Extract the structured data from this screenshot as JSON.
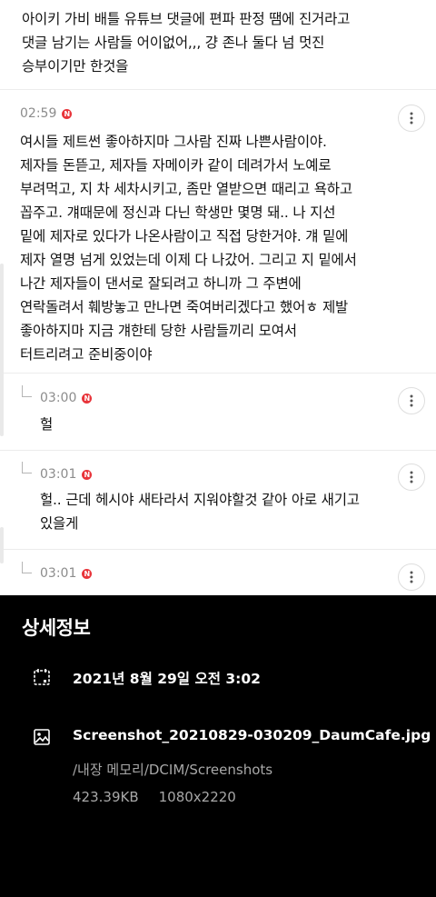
{
  "comments": {
    "top_fragment": "아이키 가비 배틀 유튜브 댓글에 편파 판정 땜에 진거라고\n댓글 남기는 사람들 어이없어,,, 걍 존나 둘다 넘 멋진\n승부이기만 한것을",
    "main": {
      "time": "02:59",
      "text": "여시들 제트썬 좋아하지마 그사람 진짜 나쁜사람이야.\n제자들 돈뜯고, 제자들 자메이카 같이 데려가서 노예로\n부려먹고, 지 차 세차시키고, 좀만 열받으면 때리고 욕하고\n꼽주고. 걔때문에 정신과 다닌 학생만 몇명 돼.. 나 지선\n밑에 제자로 있다가 나온사람이고 직접 당한거야. 걔 밑에\n제자 열명 넘게 있었는데 이제 다 나갔어. 그리고 지 밑에서\n나간 제자들이 댄서로 잘되려고 하니까 그 주변에\n연락돌려서 훼방놓고 만나면 죽여버리겠다고 했어ㅎ 제발\n좋아하지마 지금 걔한테 당한 사람들끼리 모여서\n터트리려고 준비중이야"
    },
    "replies": [
      {
        "time": "03:00",
        "text": "헐"
      },
      {
        "time": "03:01",
        "text": "헐.. 근데 헤시야 새타라서 지워야할것 같아 아로 새기고\n있을게"
      },
      {
        "time": "03:01",
        "text": ""
      }
    ],
    "badge_letter": "N"
  },
  "details": {
    "title": "상세정보",
    "date": "2021년 8월 29일 오전 3:02",
    "filename": "Screenshot_20210829-030209_DaumCafe.jpg",
    "path": "/내장 메모리/DCIM/Screenshots",
    "size": "423.39KB",
    "resolution": "1080x2220",
    "icons": {
      "date": "calendar-icon",
      "file": "image-icon"
    }
  },
  "colors": {
    "badge": "#e8343a",
    "sheet_bg": "#000000"
  }
}
